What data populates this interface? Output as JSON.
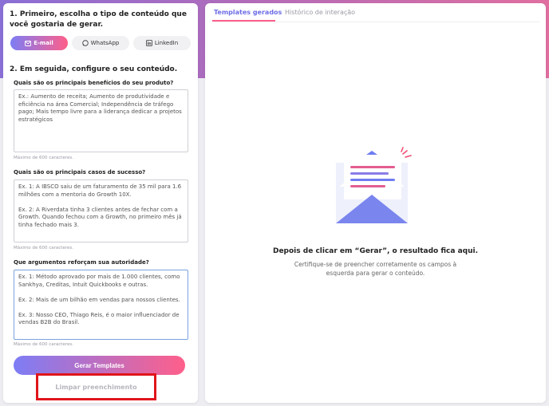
{
  "left": {
    "step1_title": "1. Primeiro, escolha o tipo de conteúdo que você gostaria de gerar.",
    "content_types": [
      {
        "label": "E-mail",
        "icon": "mail-icon",
        "active": true
      },
      {
        "label": "WhatsApp",
        "icon": "whatsapp-icon",
        "active": false
      },
      {
        "label": "LinkedIn",
        "icon": "linkedin-icon",
        "active": false
      }
    ],
    "step2_title": "2. Em seguida, configure o seu conteúdo.",
    "q1": {
      "label": "Quais são os principais benefícios do seu produto?",
      "placeholder": "Ex.: Aumento de receita; Aumento de produtividade e eficiência na área Comercial; Independência de tráfego pago; Mais tempo livre para a liderança dedicar a projetos estratégicos",
      "hint": "Máximo de 600 caracteres."
    },
    "q2": {
      "label": "Quais são os principais casos de sucesso?",
      "placeholder": "Ex. 1: A IBSCO saiu de um faturamento de 35 mil para 1.6 milhões com a mentoria do Growth 10X.\n\nEx. 2: A Riverdata tinha 3 clientes antes de fechar com a Growth. Quando fechou com a Growth, no primeiro mês já tinha fechado mais 3.",
      "hint": "Máximo de 600 caracteres."
    },
    "q3": {
      "label": "Que argumentos reforçam sua autoridade?",
      "placeholder": "Ex. 1: Método aprovado por mais de 1.000 clientes, como Sankhya, Creditas, Intuit Quickbooks e outras.\n\nEx. 2: Mais de um bilhão em vendas para nossos clientes.\n\nEx. 3: Nosso CEO, Thiago Reis, é o maior influenciador de vendas B2B do Brasil.",
      "hint": "Máximo de 600 caracteres."
    },
    "generate_label": "Gerar Templates",
    "clear_label": "Limpar preenchimento"
  },
  "right": {
    "tabs": [
      "Templates gerados",
      "Histórico de interação"
    ],
    "empty_title": "Depois de clicar em “Gerar”, o resultado fica aqui.",
    "empty_subtitle": "Certifique-se de preencher corretamente os campos à esquerda para gerar o conteúdo."
  },
  "colors": {
    "accent_start": "#7d7df5",
    "accent_end": "#ff5f8a",
    "highlight_box": "#e0151b"
  }
}
